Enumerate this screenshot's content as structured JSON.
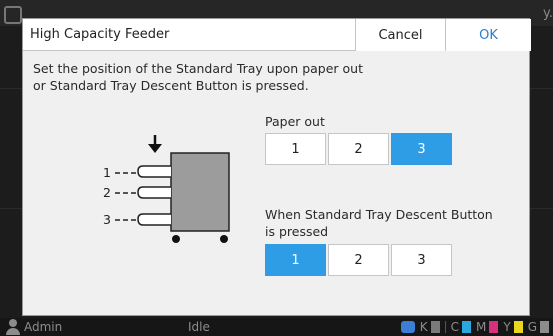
{
  "background": {
    "edge_text": "y.",
    "status": {
      "user": "Admin",
      "state": "Idle",
      "ink_labels": [
        "K",
        "C",
        "M",
        "Y",
        "G"
      ],
      "ink_colors": [
        "#7a7a7a",
        "#2aa7e0",
        "#d6307e",
        "#e8d71c",
        "#8c8c8c"
      ]
    }
  },
  "dialog": {
    "title": "High Capacity Feeder",
    "cancel_label": "Cancel",
    "ok_label": "OK",
    "description_line1": "Set the position of the Standard Tray upon paper out",
    "description_line2": "or Standard Tray Descent Button is pressed.",
    "paper_out": {
      "label": "Paper out",
      "options": [
        "1",
        "2",
        "3"
      ],
      "selected": "3"
    },
    "descent_button": {
      "label_line1": "When Standard Tray Descent Button",
      "label_line2": "is pressed",
      "options": [
        "1",
        "2",
        "3"
      ],
      "selected": "1"
    },
    "diagram": {
      "position_labels": [
        "1",
        "2",
        "3"
      ]
    }
  },
  "colors": {
    "accent": "#2f9de6",
    "ok_text": "#2a7fd0"
  }
}
